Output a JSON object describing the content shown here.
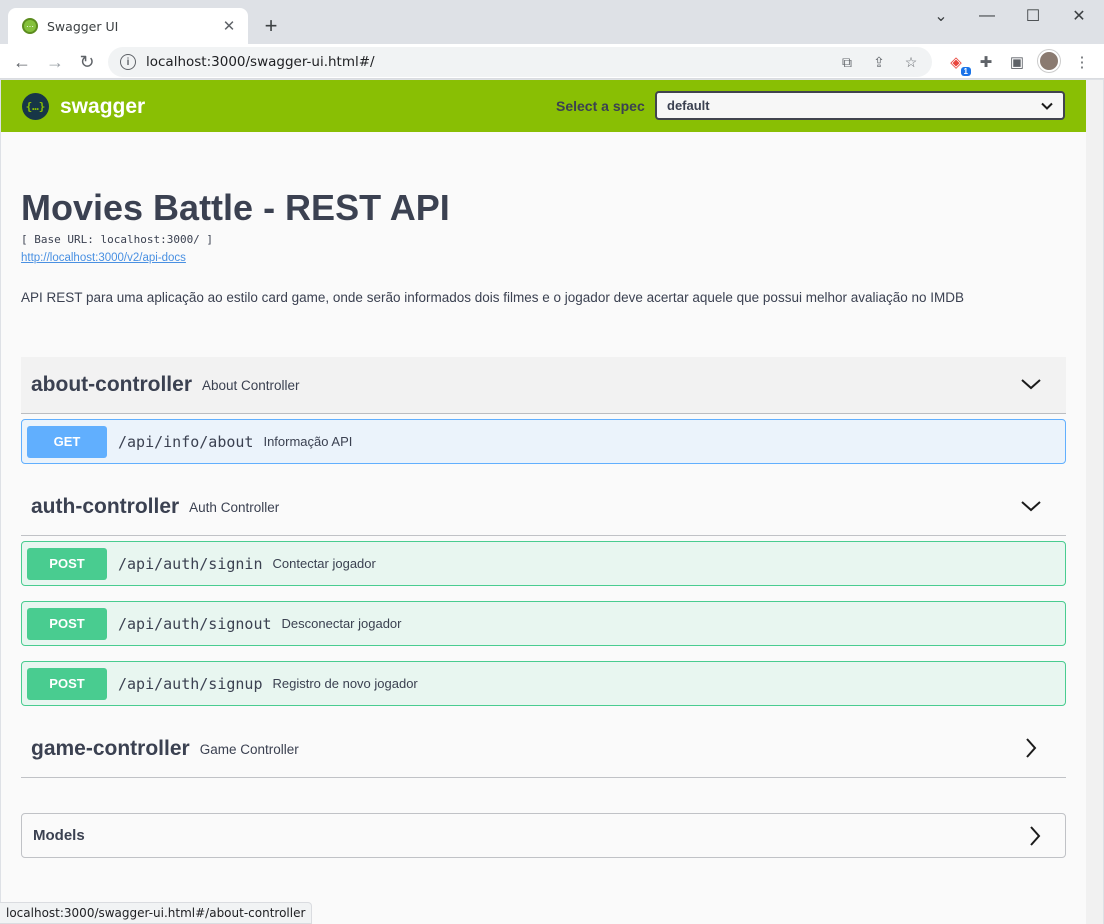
{
  "browser": {
    "tab_title": "Swagger UI",
    "url": "localhost:3000/swagger-ui.html#/",
    "extension_badge": "1",
    "status_url": "localhost:3000/swagger-ui.html#/about-controller"
  },
  "swagger": {
    "logo_text": "swagger",
    "select_spec_label": "Select a spec",
    "selected_spec": "default",
    "brand_color": "#89bf04"
  },
  "info": {
    "title": "Movies Battle - REST API",
    "base_url": "[ Base URL: localhost:3000/ ]",
    "docs_url": "http://localhost:3000/v2/api-docs",
    "description": "API REST para uma aplicação ao estilo card game, onde serão informados dois filmes e o jogador deve acertar aquele que possui melhor avaliação no IMDB"
  },
  "tags": [
    {
      "name": "about-controller",
      "description": "About Controller",
      "expanded": true,
      "operations": [
        {
          "method": "GET",
          "path": "/api/info/about",
          "summary": "Informação API"
        }
      ]
    },
    {
      "name": "auth-controller",
      "description": "Auth Controller",
      "expanded": true,
      "operations": [
        {
          "method": "POST",
          "path": "/api/auth/signin",
          "summary": "Contectar jogador"
        },
        {
          "method": "POST",
          "path": "/api/auth/signout",
          "summary": "Desconectar jogador"
        },
        {
          "method": "POST",
          "path": "/api/auth/signup",
          "summary": "Registro de novo jogador"
        }
      ]
    },
    {
      "name": "game-controller",
      "description": "Game Controller",
      "expanded": false,
      "operations": []
    }
  ],
  "models": {
    "label": "Models"
  },
  "colors": {
    "get": "#61affe",
    "post": "#49cc90",
    "text": "#3b4151"
  }
}
